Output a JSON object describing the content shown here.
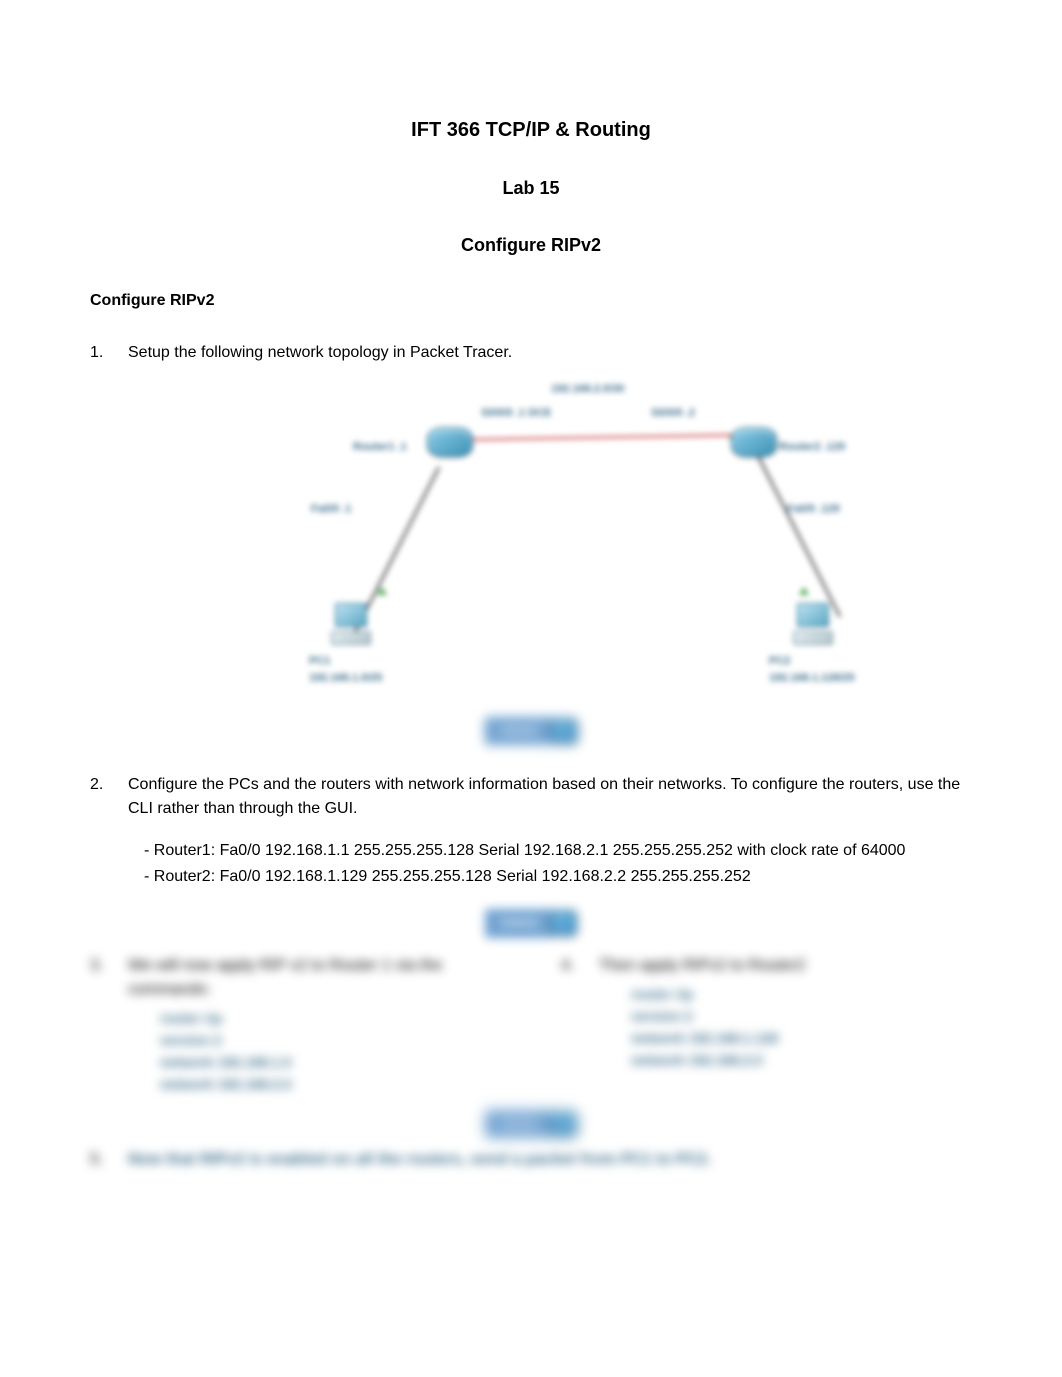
{
  "header": {
    "course": "IFT 366 TCP/IP & Routing",
    "lab": "Lab 15",
    "topic": "Configure RIPv2"
  },
  "section_heading": "Configure RIPv2",
  "steps": {
    "s1": {
      "num": "1.",
      "text": "Setup the following network topology in Packet Tracer."
    },
    "s2": {
      "num": "2.",
      "text": "Configure the PCs and the routers with network information based on their networks. To configure the routers, use the CLI rather than through the GUI."
    }
  },
  "config": {
    "r1": "- Router1: Fa0/0 192.168.1.1 255.255.255.128 Serial 192.168.2.1 255.255.255.252 with clock rate of 64000",
    "r2": "- Router2: Fa0/0 192.168.1.129 255.255.255.128 Serial 192.168.2.2 255.255.255.252"
  },
  "topology": {
    "serial_net": "192.168.2.0/30",
    "r1_s": "S0/0/0 .1 DCE",
    "r2_s": "S0/0/0 .2",
    "r1_name": "Router1 .1",
    "r2_name": "Router2 .129",
    "r1_fa": "Fa0/0 .1",
    "r2_fa": "Fa0/0 .129",
    "pc1": "PC1\n192.168.1.0/25",
    "pc2": "PC2\n192.168.1.128/25"
  },
  "pager": {
    "label": "Unlock"
  },
  "blurred": {
    "s3": {
      "num": "3.",
      "text": "We will now apply RIP v2 to Router 1 via the commands:"
    },
    "s3_cmds": {
      "a": "router rip",
      "b": "version 2",
      "c": "network 192.168.1.0",
      "d": "network 192.168.2.0"
    },
    "s4": {
      "num": "4.",
      "text": "Then apply RIPv2 to Router2"
    },
    "s4_cmds": {
      "a": "router rip",
      "b": "version 2",
      "c": "network 192.168.1.128",
      "d": "network 192.168.2.0"
    },
    "s5": {
      "num": "5.",
      "text": "Now that RIPv2 is enabled on all the routers, send a packet from PC1 to PC2."
    }
  }
}
